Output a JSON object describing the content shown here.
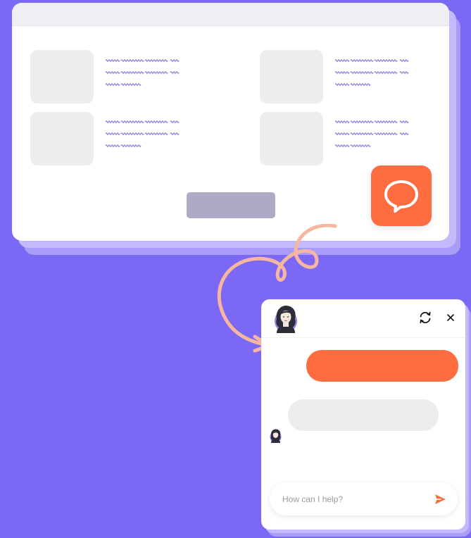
{
  "colors": {
    "background": "#7b68f5",
    "accent": "#ff6c40",
    "tile": "#ededed",
    "button": "#aeaac6",
    "squiggle": "#7b6fd9"
  },
  "browser": {
    "tiles_count": 4
  },
  "launcher": {
    "icon": "speech-bubble-icon"
  },
  "chat": {
    "refresh_icon": "refresh-icon",
    "close_icon": "close-icon",
    "input_placeholder": "How can I help?",
    "send_icon": "send-icon"
  }
}
